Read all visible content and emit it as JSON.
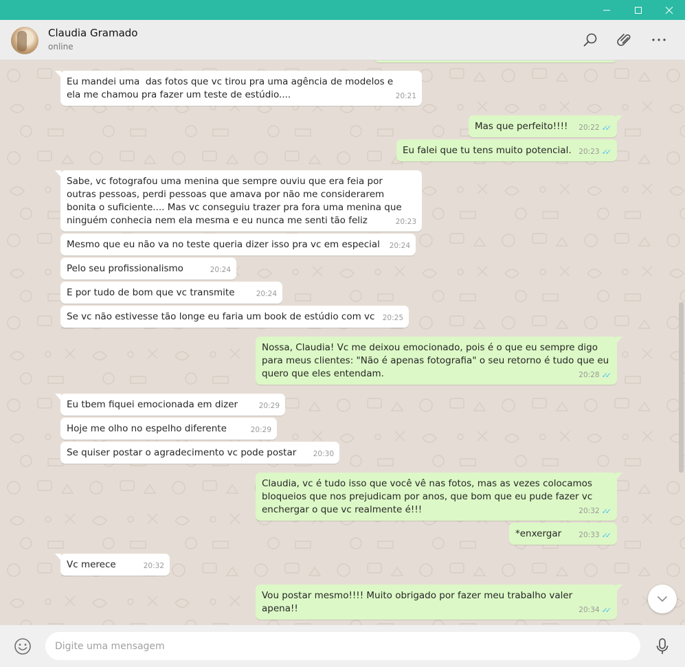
{
  "window": {
    "minimize_icon": "minimize-icon",
    "maximize_icon": "maximize-icon",
    "close_icon": "close-icon"
  },
  "header": {
    "contact_name": "Claudia Gramado",
    "status": "online",
    "icons": [
      "search-icon",
      "paperclip-icon",
      "more-icon"
    ]
  },
  "colors": {
    "titlebar": "#2bbaa4",
    "incoming": "#ffffff",
    "outgoing": "#dcf8c6",
    "read_ticks": "#4fc3f7",
    "chat_bg": "#e5ddd5"
  },
  "messages": [
    {
      "dir": "in",
      "text": "Eu mandei uma  das fotos que vc tirou pra uma agência de modelos e ela me chamou pra fazer um teste de estúdio....",
      "time": "20:21",
      "tail": true
    },
    {
      "dir": "out",
      "text": "Mas que perfeito!!!!",
      "time": "20:22",
      "ticks": "read",
      "tail": true
    },
    {
      "dir": "out",
      "text": "Eu falei que tu tens muito potencial.",
      "time": "20:23",
      "ticks": "read",
      "tail": false
    },
    {
      "dir": "in",
      "text": "Sabe, vc fotografou uma menina que sempre ouviu que era feia por outras pessoas, perdi pessoas que amava por não me considerarem bonita o suficiente.... Mas vc conseguiu trazer pra fora uma menina que ninguém conhecia nem ela mesma e eu nunca me senti tão feliz",
      "time": "20:23",
      "tail": true
    },
    {
      "dir": "in",
      "text": "Mesmo que eu não va no teste queria dizer isso pra vc em especial",
      "time": "20:24",
      "tail": false
    },
    {
      "dir": "in",
      "text": "Pelo seu profissionalismo",
      "time": "20:24",
      "tail": false
    },
    {
      "dir": "in",
      "text": "E por tudo de bom que vc transmite",
      "time": "20:24",
      "tail": false
    },
    {
      "dir": "in",
      "text": "Se vc não estivesse tão longe eu faria um book de estúdio com vc",
      "time": "20:25",
      "tail": false
    },
    {
      "dir": "out",
      "text": "Nossa, Claudia! Vc me deixou emocionado, pois é o que eu sempre digo para meus clientes: \"Não é apenas fotografia\" o seu retorno é tudo que eu quero que eles entendam.",
      "time": "20:28",
      "ticks": "read",
      "tail": true
    },
    {
      "dir": "in",
      "text": "Eu tbem fiquei emocionada em dizer",
      "time": "20:29",
      "tail": true
    },
    {
      "dir": "in",
      "text": "Hoje me olho no espelho diferente",
      "time": "20:29",
      "tail": false
    },
    {
      "dir": "in",
      "text": "Se quiser postar o agradecimento vc pode postar",
      "time": "20:30",
      "tail": false
    },
    {
      "dir": "out",
      "text": "Claudia, vc é tudo isso que você vê nas fotos, mas as vezes colocamos bloqueios que nos prejudicam por anos, que bom que eu pude fazer vc enchergar o que vc realmente é!!!",
      "time": "20:32",
      "ticks": "read",
      "tail": true
    },
    {
      "dir": "out",
      "text": "*enxergar",
      "time": "20:33",
      "ticks": "read",
      "tail": false
    },
    {
      "dir": "in",
      "text": "Vc merece",
      "time": "20:32",
      "tail": true
    },
    {
      "dir": "out",
      "text": "Vou postar mesmo!!!! Muito obrigado por fazer meu trabalho valer apena!!",
      "time": "20:34",
      "ticks": "read",
      "tail": true
    }
  ],
  "composer": {
    "placeholder": "Digite uma mensagem",
    "emoji_icon": "emoji-icon",
    "mic_icon": "microphone-icon"
  },
  "scroll_down_icon": "chevron-down-icon"
}
